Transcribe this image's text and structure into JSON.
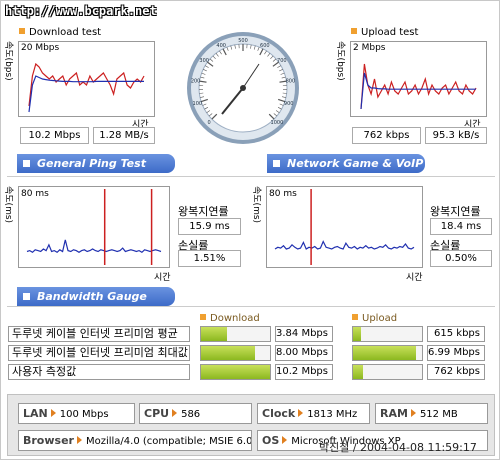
{
  "watermark": "http://www.bcpark.net",
  "download_test": {
    "title": "Download test",
    "scale": "20 Mbps",
    "ylabel": "속도(bps)",
    "xlabel": "시간",
    "mbps": "10.2 Mbps",
    "mbs": "1.28 MB/s",
    "lines": {
      "red": [
        2,
        12,
        16,
        15,
        13,
        12,
        11,
        12,
        10,
        11,
        12,
        9,
        11,
        12,
        13,
        9,
        10,
        9,
        12,
        10,
        11,
        12,
        13,
        11,
        9,
        6,
        11,
        12,
        13,
        9,
        8,
        10,
        11,
        10,
        12
      ],
      "blue": [
        0,
        9,
        12,
        11.5,
        11,
        10.8,
        10.6,
        10.5,
        10.4,
        10.3,
        10.2,
        10.2,
        10.2,
        10.1,
        10.1,
        10.1,
        10.1,
        10.1,
        10.1,
        10.1,
        10.2,
        10.2,
        10.2,
        10.2,
        10.2,
        10.2,
        10.2,
        10.2,
        10.2,
        10.2,
        10.2,
        10.2,
        10.2,
        10.2,
        10.2
      ],
      "colors": {
        "red": "#cc2020",
        "blue": "#2030b0"
      }
    }
  },
  "upload_test": {
    "title": "Upload test",
    "scale": "2 Mbps",
    "ylabel": "속도(bps)",
    "xlabel": "시간",
    "kbps": "762 kbps",
    "kbs": "95.3 kB/s",
    "lines": {
      "red": [
        0.1,
        1.6,
        0.9,
        0.6,
        1.1,
        0.5,
        0.7,
        0.9,
        0.6,
        1.0,
        0.7,
        0.6,
        0.8,
        1.0,
        0.6,
        0.7,
        0.9,
        0.6,
        0.8,
        1.1,
        0.6,
        0.9,
        0.7,
        0.6,
        0.8,
        0.9,
        0.6,
        0.8,
        1.0,
        0.7,
        0.6,
        0.9,
        0.7,
        0.6,
        0.8
      ],
      "blue": [
        0.1,
        1.3,
        0.9,
        0.8,
        0.8,
        0.78,
        0.77,
        0.77,
        0.76,
        0.76,
        0.76,
        0.76,
        0.76,
        0.76,
        0.76,
        0.76,
        0.76,
        0.76,
        0.76,
        0.76,
        0.76,
        0.76,
        0.76,
        0.76,
        0.76,
        0.76,
        0.76,
        0.76,
        0.76,
        0.76,
        0.76,
        0.76,
        0.76,
        0.76,
        0.76
      ],
      "colors": {
        "red": "#cc2020",
        "blue": "#2030b0"
      }
    }
  },
  "gauge": {
    "labels": [
      "0",
      "100",
      "200",
      "300",
      "400",
      "500",
      "600",
      "700",
      "800",
      "900",
      "1000"
    ]
  },
  "bands": {
    "general_ping": "General Ping Test",
    "network_game": "Network Game & VoIP Test",
    "bandwidth_gauge": "Bandwidth Gauge"
  },
  "ping_left": {
    "scale": "80 ms",
    "ylabel": "속도(ms)",
    "xlabel": "시간",
    "latency_label": "왕복지연률",
    "latency": "15.9 ms",
    "loss_label": "손실률",
    "loss": "1.51%",
    "samples": [
      14,
      15,
      13,
      16,
      15,
      14,
      17,
      15,
      22,
      14,
      15,
      13,
      16,
      14,
      28,
      15,
      14,
      16,
      15,
      13,
      15,
      16,
      14,
      15,
      17,
      15,
      14,
      16,
      15,
      14,
      15,
      16,
      15,
      14,
      15,
      18,
      14,
      15,
      16,
      15,
      14,
      15,
      13,
      16,
      15,
      14,
      15,
      16,
      15,
      14
    ],
    "spikes": [
      0.58,
      0.93
    ],
    "colors": {
      "line": "#2030b0",
      "spike": "#cc2020"
    }
  },
  "ping_right": {
    "scale": "80 ms",
    "ylabel": "속도(ms)",
    "xlabel": "시간",
    "latency_label": "왕복지연률",
    "latency": "18.4 ms",
    "loss_label": "손실률",
    "loss": "0.50%",
    "samples": [
      17,
      19,
      18,
      21,
      17,
      18,
      22,
      19,
      17,
      18,
      25,
      17,
      19,
      18,
      20,
      17,
      18,
      26,
      19,
      18,
      17,
      19,
      20,
      18,
      17,
      24,
      19,
      18,
      20,
      17,
      19,
      18,
      21,
      18,
      19,
      17,
      18,
      20,
      19,
      22,
      18,
      17,
      19,
      18,
      20,
      19,
      23,
      18,
      17,
      19
    ],
    "spikes": [
      0.26
    ],
    "colors": {
      "line": "#2030b0",
      "spike": "#cc2020"
    }
  },
  "bandwidth": {
    "download_header": "Download",
    "upload_header": "Upload",
    "rows": [
      {
        "label": "두루넷 케이블 인터넷 프리미엄 평균",
        "down_value": "3.84 Mbps",
        "down_level": 0.376,
        "up_value": "615 kbps",
        "up_level": 0.12
      },
      {
        "label": "두루넷 케이블 인터넷 프리미엄 최대값",
        "down_value": "8.00 Mbps",
        "down_level": 0.784,
        "up_value": "6.99 Mbps",
        "up_level": 0.92
      },
      {
        "label": "사용자 측정값",
        "down_value": "10.2 Mbps",
        "down_level": 1.0,
        "up_value": "762 kbps",
        "up_level": 0.14
      }
    ]
  },
  "system": {
    "lan": {
      "key": "LAN",
      "value": "100 Mbps"
    },
    "cpu": {
      "key": "CPU",
      "value": "586"
    },
    "clock": {
      "key": "Clock",
      "value": "1813 MHz"
    },
    "ram": {
      "key": "RAM",
      "value": "512 MB"
    },
    "browser": {
      "key": "Browser",
      "value": "Mozilla/4.0 (compatible; MSIE 6.0"
    },
    "os": {
      "key": "OS",
      "value": "Microsoft Windows XP"
    }
  },
  "credit": "박진철 / 2004-04-08 11:59:17"
}
